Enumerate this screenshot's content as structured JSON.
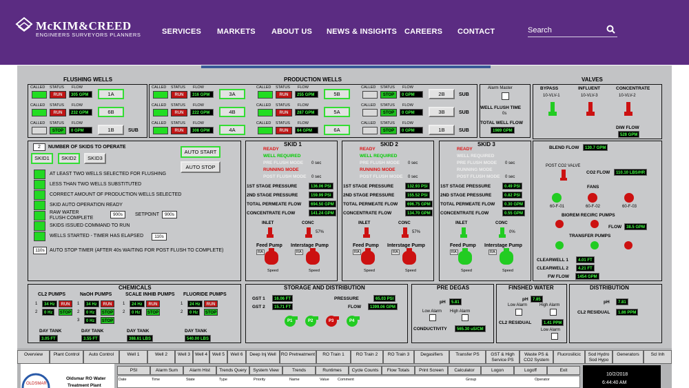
{
  "site": {
    "brand": "McKIM&CREED",
    "tagline": "ENGINEERS  SURVEYORS  PLANNERS",
    "nav": [
      "SERVICES",
      "MARKETS",
      "ABOUT US",
      "NEWS & INSIGHTS",
      "CAREERS",
      "CONTACT"
    ],
    "search_placeholder": "Search"
  },
  "colors": {
    "header": "#5b2c82",
    "panel": "#c2c3c5",
    "running": "#cc1111",
    "ok": "#22dd22"
  },
  "flushing": {
    "title": "FLUSHING WELLS",
    "hdr": [
      "CALLED",
      "STATUS",
      "FLOW"
    ],
    "rows": [
      {
        "status": "RUN",
        "flow": "305 GPM",
        "btn": "1A"
      },
      {
        "status": "RUN",
        "flow": "232 GPM",
        "btn": "6B"
      },
      {
        "status": "STOP",
        "flow": "0 GPM",
        "btn": "1B",
        "sub": "SUB"
      }
    ]
  },
  "production": {
    "title": "PRODUCTION WELLS",
    "hdr": [
      "CALLED",
      "STATUS",
      "FLOW"
    ],
    "cols": [
      [
        {
          "status": "RUN",
          "flow": "316 GPM",
          "btn": "3A"
        },
        {
          "status": "RUN",
          "flow": "222 GPM",
          "btn": "4B"
        },
        {
          "status": "RUN",
          "flow": "308 GPM",
          "btn": "4A"
        }
      ],
      [
        {
          "status": "RUN",
          "flow": "255 GPM",
          "btn": "5B"
        },
        {
          "status": "RUN",
          "flow": "287 GPM",
          "btn": "5A"
        },
        {
          "status": "RUN",
          "flow": "64 GPM",
          "btn": "6A"
        }
      ],
      [
        {
          "status": "STOP",
          "flow": "0 GPM",
          "btn": "2B",
          "sub": "SUB"
        },
        {
          "status": "STOP",
          "flow": "0 GPM",
          "btn": "3B",
          "sub": "SUB"
        },
        {
          "status": "STOP",
          "flow": "0 GPM",
          "btn": "1B",
          "sub": "SUB"
        }
      ]
    ]
  },
  "alarm": {
    "master": "Alarm Master",
    "flush_time": "WELL FLUSH TIME",
    "flush_val": "0s",
    "total_flow": "TOTAL WELL FLOW",
    "total_val": "1989 GPM"
  },
  "valves": {
    "title": "VALVES",
    "items": [
      {
        "name": "BYPASS",
        "tag": "10-VLV-1"
      },
      {
        "name": "INFLUENT",
        "tag": "10-VLV-3"
      },
      {
        "name": "CONCENTRATE",
        "tag": "10-VLV-2"
      }
    ],
    "diw_label": "DIW FLOW",
    "diw_val": "528 GPM"
  },
  "control": {
    "num_skids": "2",
    "num_label": "NUMBER OF SKIDS TO OPERATE",
    "skid_btns": [
      "SKID1",
      "SKID2",
      "SKID3"
    ],
    "auto_start": "AUTO START",
    "auto_stop": "AUTO STOP",
    "conds": [
      "AT LEAST TWO WELLS SELECTED FOR FLUSHING",
      "LESS THAN TWO WELLS SUBSTITUTED",
      "CORRECT AMOUNT OF PRODUCTION WELLS SELECTED",
      "SKID AUTO OPERATION READY",
      "RAW WATER",
      "FLUSH COMPLETE",
      "SKIDS ISSUED COMMAND TO RUN",
      "WELLS STARTED - TIMER HAS ELAPSED"
    ],
    "raw_val": "900s",
    "setpoint": "SETPOINT",
    "setpoint_val": "900s",
    "elapsed_val": "110s",
    "timer_val": "110s",
    "timer_text": "AUTO STOP TIMER (AFTER 40s WAITING FOR POST FLUSH TO COMPLETE)"
  },
  "skids": [
    {
      "title": "SKID 1",
      "modes": [
        "READY",
        "WELL REQUIRED",
        "PRE FLUSH MODE",
        "RUNNING MODE",
        "POST FLUSH MODE"
      ],
      "sec1": "0 sec",
      "sec2": "0 sec",
      "p1": "136.06 PSI",
      "p2": "159.99 PSI",
      "perm": "694.50 GPM",
      "conc": "141.24 GPM",
      "pct": "57%"
    },
    {
      "title": "SKID 2",
      "modes": [
        "READY",
        "WELL REQUIRED",
        "PRE FLUSH MODE",
        "RUNNING MODE",
        "POST FLUSH MODE"
      ],
      "sec1": "0 sec",
      "sec2": "0 sec",
      "p1": "132.93 PSI",
      "p2": "155.52 PSI",
      "perm": "696.75 GPM",
      "conc": "134.70 GPM",
      "pct": "57%"
    },
    {
      "title": "SKID 3",
      "modes": [
        "READY",
        "WELL REQUIRED",
        "PRE FLUSH MODE",
        "RUNNING MODE",
        "POST FLUSH MODE"
      ],
      "sec1": "0 sec",
      "sec2": "0 sec",
      "p1": "0.49 PSI",
      "p2": "0.82 PSI",
      "perm": "0.30 GPM",
      "conc": "0.55 GPM",
      "pct": "0%"
    }
  ],
  "skid_labels": {
    "p1": "1ST STAGE PRESSURE",
    "p2": "2ND STAGE PRESSURE",
    "perm": "TOTAL PERMEATE FLOW",
    "conc": "CONCENTRATE FLOW",
    "inlet": "INLET",
    "concv": "CONC",
    "feed": "Feed Pump",
    "inter": "Interstage Pump",
    "speed": "Speed",
    "ra": "RA"
  },
  "blend": {
    "blend_label": "BLEND FLOW",
    "blend_val": "130.7 GPM",
    "co2_valve": "POST CO2 VALVE",
    "co2_label": "CO2 FLOW",
    "co2_val": "110.10 LBS/HR",
    "fans": "FANS",
    "fan_tags": [
      "60-F-01",
      "60-F-02",
      "60-F-03"
    ],
    "biorem": "BIOREM RECIRC PUMPS",
    "flow_label": "FLOW",
    "flow_val": "38.5 GPM",
    "transfer": "TRANSFER PUMPS",
    "cw1": "CLEARWELL 1",
    "cw1_val": "4.01 FT",
    "cw2": "CLEARWELL 2",
    "cw2_val": "4.21 FT",
    "fw": "FW FLOW",
    "fw_val": "1454 GPM"
  },
  "chemicals": {
    "title": "CHEMICALS",
    "groups": [
      {
        "name": "CL2 PUMPS",
        "rows": [
          [
            "34 Hz",
            "RUN"
          ],
          [
            "0 Hz",
            "STOP"
          ]
        ],
        "day": "DAY TANK",
        "tank": "3.05 FT"
      },
      {
        "name": "NaOH PUMPS",
        "rows": [
          [
            "34 Hz",
            "RUN"
          ],
          [
            "0 Hz",
            "STOP"
          ],
          [
            "0 Hz",
            "STOP"
          ]
        ],
        "day": "DAY TANK",
        "tank": "3.55 FT"
      },
      {
        "name": "SCALE INHIB PUMPS",
        "rows": [
          [
            "24 Hz",
            "RUN"
          ],
          [
            "0 Hz",
            "STOP"
          ]
        ],
        "day": "DAY TANK",
        "tank": "388.61 LBS"
      },
      {
        "name": "FLUORIDE PUMPS",
        "rows": [
          [
            "24 Hz",
            "RUN"
          ],
          [
            "0 Hz",
            "STOP"
          ]
        ],
        "day": "DAY TANK",
        "tank": "540.00 LBS"
      }
    ]
  },
  "storage": {
    "title": "STORAGE AND DISTRIBUTION",
    "gst1": "GST 1",
    "gst1_val": "16.06 FT",
    "gst2": "GST 2",
    "gst2_val": "15.71 FT",
    "pressure": "PRESSURE",
    "pressure_val": "65.03 PSI",
    "flow": "FLOW",
    "flow_val": "1399.06 GPM",
    "pumps": [
      "P1",
      "P2",
      "P3",
      "P4"
    ]
  },
  "predegas": {
    "title": "PRE DEGAS",
    "ph": "pH",
    "ph_val": "5.81",
    "low": "Low Alarm",
    "high": "High Alarm",
    "cond": "CONDUCTIVITY",
    "cond_val": "565.30 uS/CM"
  },
  "finished": {
    "title": "FINSHED WATER",
    "ph": "pH",
    "ph_val": "7.85",
    "low": "Low Alarm",
    "high": "High Alarm",
    "cl2": "CL2 RESIDUAL",
    "cl2_val": "1.41 PPM",
    "low2": "Low Alarm"
  },
  "distribution": {
    "title": "DISTRIBUTION",
    "ph": "pH",
    "ph_val": "7.81",
    "cl2": "CL2 RESIDUAL",
    "cl2_val": "1.86 PPM"
  },
  "tabs": [
    "Overview",
    "Plant Control",
    "Auto Control",
    "Well 1",
    "Well 2",
    "Well 3",
    "Well 4",
    "Well 5",
    "Well 6",
    "Deep Inj Well",
    "RO Pretreatment",
    "RO Train 1",
    "RO Train 2",
    "RO Train 3",
    "Degasifiers",
    "Transfer PS",
    "GST & High Service PS",
    "Waste PS & CO2 System",
    "Fluorosilicic",
    "Sod Hydro Sod Hypo",
    "Generators",
    "Scl Inh"
  ],
  "subtabs": [
    "PSI",
    "Alarm Sum",
    "Alarm Hist",
    "Trends Query",
    "System View",
    "Trends",
    "Runtimes",
    "Cycle Counts",
    "Flow Totals",
    "Print Screen",
    "Calculator",
    "Logon",
    "Logoff",
    "Exit"
  ],
  "columns": [
    "Date",
    "Time",
    "State",
    "Type",
    "Priority",
    "Name",
    "Value",
    "Comment",
    "Group",
    "Operator"
  ],
  "footer": {
    "plant_line1": "Oldsmar RO Water",
    "plant_line2": "Treatment Plant",
    "date": "10/2/2018",
    "time": "6:44:40 AM"
  }
}
